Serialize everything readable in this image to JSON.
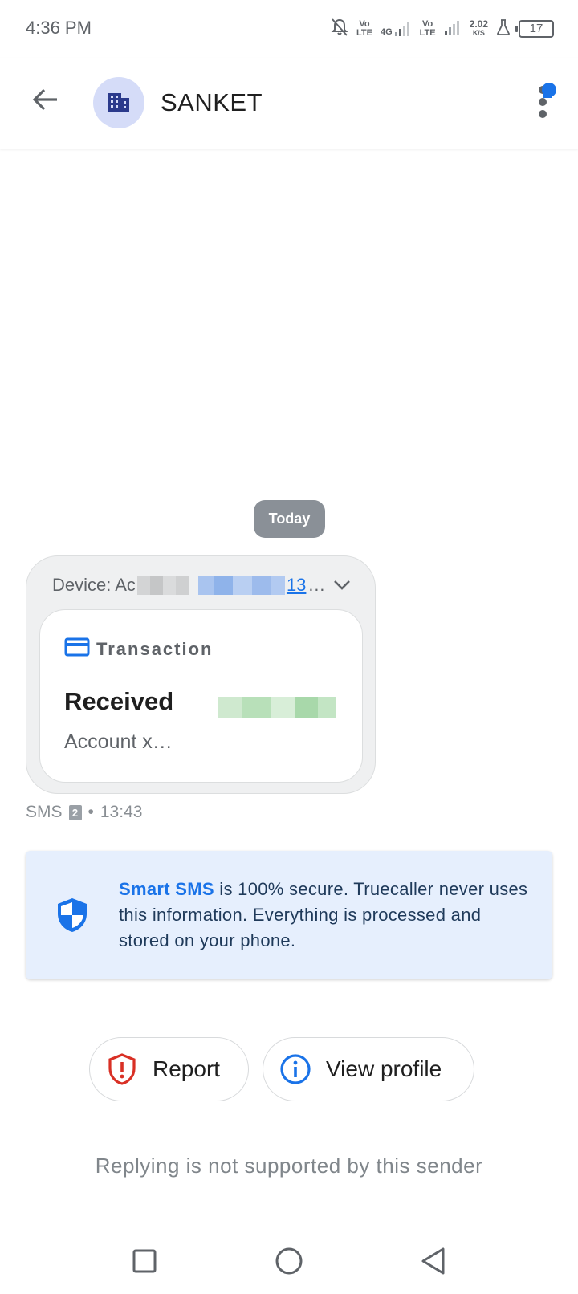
{
  "status_bar": {
    "time": "4:36 PM",
    "sim1_label_top": "Vo",
    "sim1_label_bottom": "LTE",
    "network_type": "4G",
    "sim2_label_top": "Vo",
    "sim2_label_bottom": "LTE",
    "speed_value": "2.02",
    "speed_unit": "K/S",
    "battery_level": "17",
    "icons": [
      "mute-bell-icon",
      "signal-icon",
      "signal-icon",
      "flask-icon",
      "battery-icon"
    ]
  },
  "app_bar": {
    "contact_name": "SANKET",
    "avatar_icon": "building-icon",
    "back_icon": "arrow-back-icon",
    "menu_icon": "more-vert-icon"
  },
  "conversation": {
    "date_chip": "Today",
    "message": {
      "header_prefix": "Device: Ac",
      "header_link_suffix": "13",
      "header_ellipsis": "…",
      "card_title": "Transaction",
      "card_status": "Received",
      "card_account": "Account x…",
      "meta_channel": "SMS",
      "meta_sim": "2",
      "meta_separator": "•",
      "meta_time": "13:43"
    }
  },
  "info_card": {
    "highlight": "Smart SMS",
    "text": " is 100% secure. Truecaller never uses this information. Everything is processed and stored on your phone."
  },
  "actions": {
    "report_label": "Report",
    "view_profile_label": "View profile"
  },
  "footer_note": "Replying is not supported by this sender",
  "colors": {
    "accent": "#1a73e8",
    "report_red": "#d93025",
    "info_bg": "#e6effd",
    "avatar_bg": "#d5dcf8",
    "chip_bg": "#8a9097"
  }
}
